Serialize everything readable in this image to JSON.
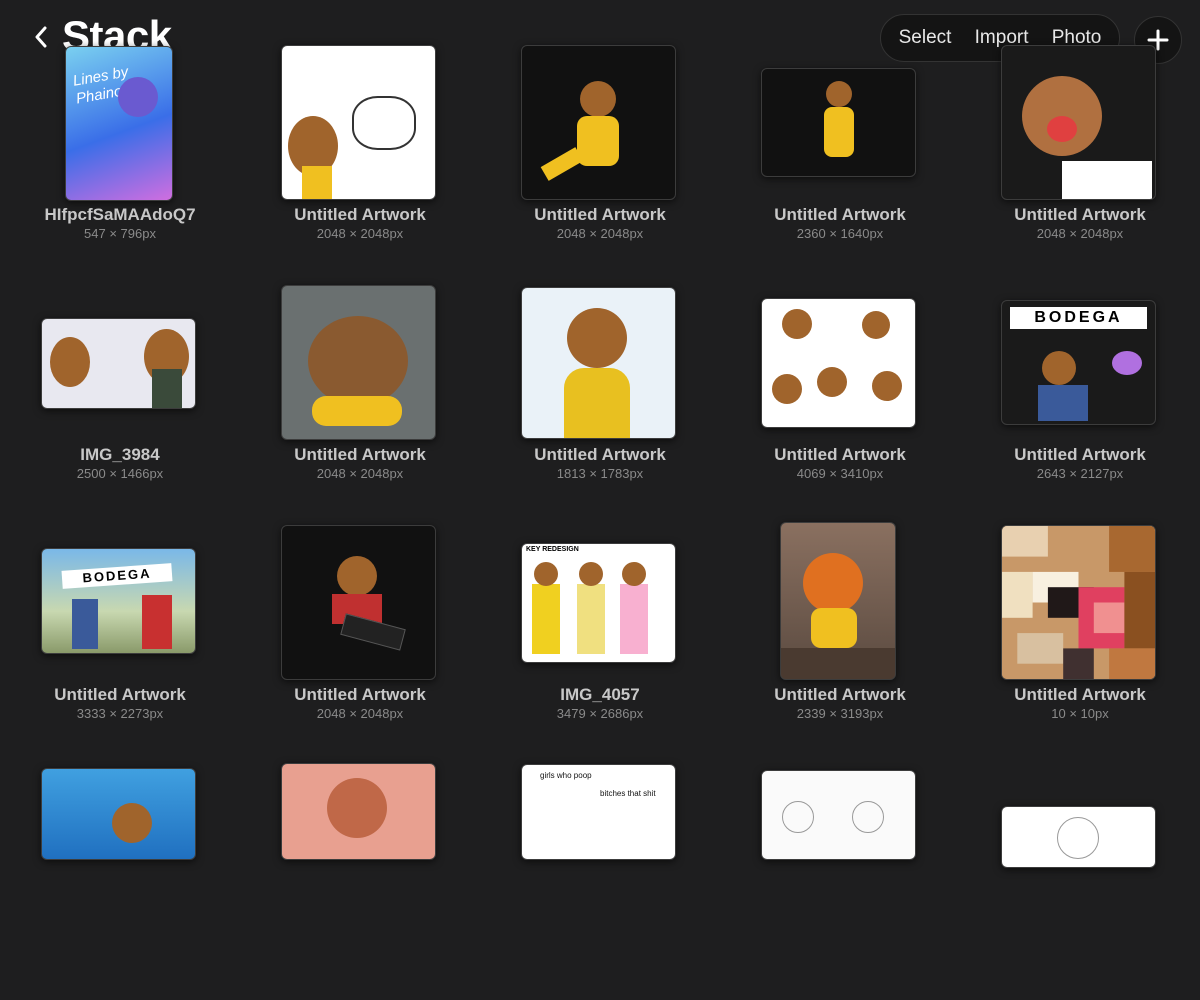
{
  "header": {
    "title": "Stack",
    "actions": [
      "Select",
      "Import",
      "Photo"
    ]
  },
  "artworks": [
    {
      "name": "HIfpcfSaMAAdoQ7",
      "size": "547 × 796px"
    },
    {
      "name": "Untitled Artwork",
      "size": "2048 × 2048px"
    },
    {
      "name": "Untitled Artwork",
      "size": "2048 × 2048px"
    },
    {
      "name": "Untitled Artwork",
      "size": "2360 × 1640px"
    },
    {
      "name": "Untitled Artwork",
      "size": "2048 × 2048px"
    },
    {
      "name": "IMG_3984",
      "size": "2500 × 1466px"
    },
    {
      "name": "Untitled Artwork",
      "size": "2048 × 2048px"
    },
    {
      "name": "Untitled Artwork",
      "size": "1813 × 1783px"
    },
    {
      "name": "Untitled Artwork",
      "size": "4069 × 3410px"
    },
    {
      "name": "Untitled Artwork",
      "size": "2643 × 2127px"
    },
    {
      "name": "Untitled Artwork",
      "size": "3333 × 2273px"
    },
    {
      "name": "Untitled Artwork",
      "size": "2048 × 2048px"
    },
    {
      "name": "IMG_4057",
      "size": "3479 × 2686px"
    },
    {
      "name": "Untitled Artwork",
      "size": "2339 × 3193px"
    },
    {
      "name": "Untitled Artwork",
      "size": "10 × 10px"
    },
    {
      "name": "",
      "size": ""
    },
    {
      "name": "",
      "size": ""
    },
    {
      "name": "",
      "size": ""
    },
    {
      "name": "",
      "size": ""
    },
    {
      "name": "",
      "size": ""
    }
  ],
  "thumb_text": {
    "t0": "Lines by Phainon",
    "t9": "BODEGA",
    "t10": "BODEGA",
    "t12": "KEY REDESIGN",
    "t17a": "girls who poop",
    "t17b": "bitches that shit"
  },
  "colors": {
    "background": "#1e1e1f",
    "toolbar": "#141414"
  }
}
